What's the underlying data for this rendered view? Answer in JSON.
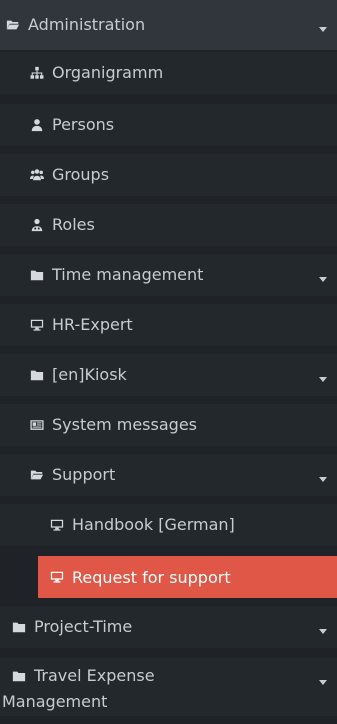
{
  "menu": {
    "administration": "Administration",
    "organigramm": "Organigramm",
    "persons": "Persons",
    "groups": "Groups",
    "roles": "Roles",
    "time_management": "Time management",
    "hr_expert": "HR-Expert",
    "kiosk": "[en]Kiosk",
    "system_messages": "System messages",
    "support": "Support",
    "handbook": "Handbook [German]",
    "request_support": "Request for support",
    "project_time": "Project-Time",
    "travel_expense_1": "Travel Expense",
    "travel_expense_2": "Management"
  },
  "colors": {
    "background": "#1f2327",
    "active": "#e05747",
    "text": "#c7ccd1"
  },
  "icons": {
    "folder_open": "folder-open-icon",
    "folder": "folder-icon",
    "sitemap": "sitemap-icon",
    "user": "user-icon",
    "group": "group-icon",
    "roles": "user-tie-icon",
    "monitor": "monitor-icon",
    "message": "message-icon"
  }
}
